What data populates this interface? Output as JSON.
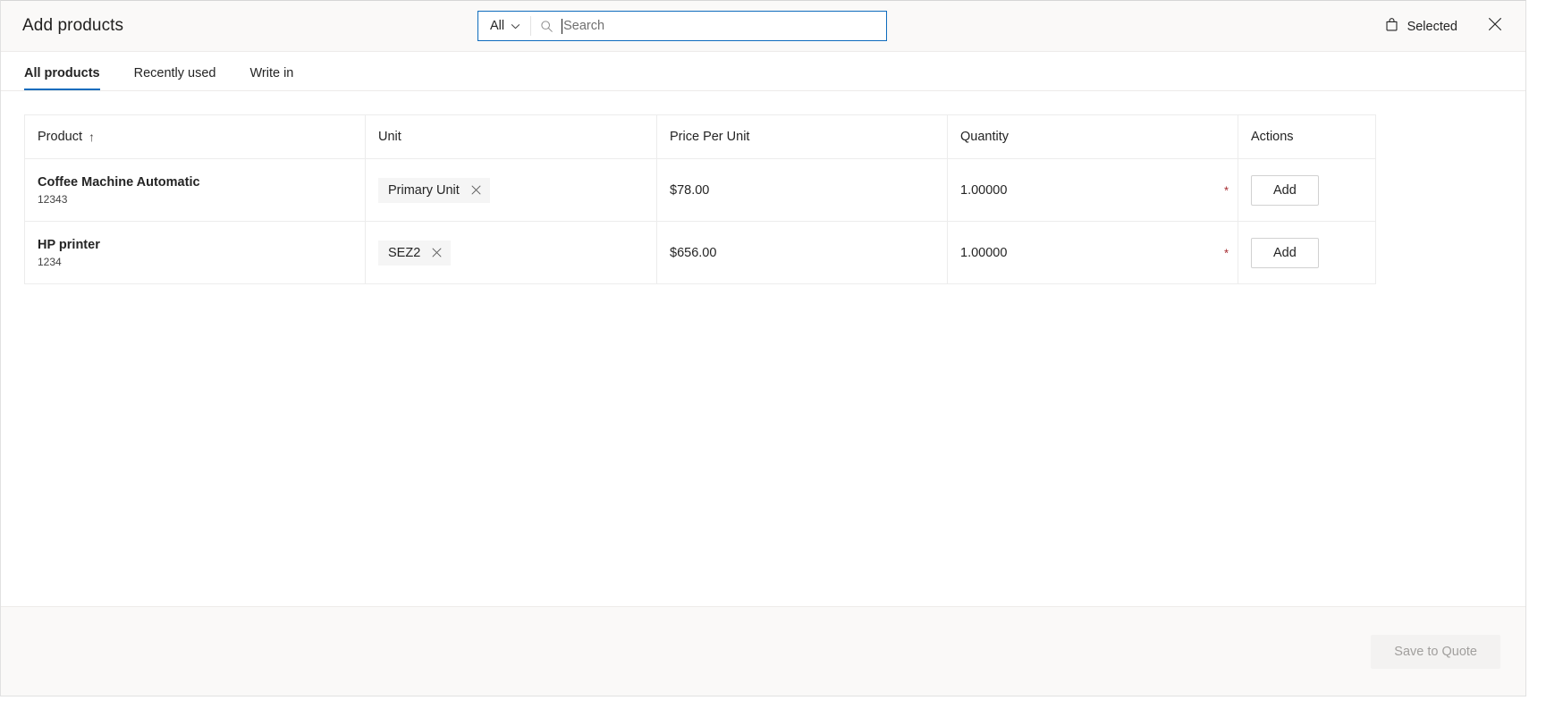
{
  "dialog": {
    "title": "Add products"
  },
  "search": {
    "scope_label": "All",
    "scope_icon": "chevron-down-icon",
    "icon": "search-icon",
    "placeholder": "Search",
    "value": ""
  },
  "header_actions": {
    "selected_label": "Selected",
    "selected_icon": "shopping-bag-icon",
    "close_icon": "close-icon"
  },
  "tabs": [
    {
      "label": "All products",
      "selected": true
    },
    {
      "label": "Recently used",
      "selected": false
    },
    {
      "label": "Write in",
      "selected": false
    }
  ],
  "table": {
    "columns": [
      {
        "label": "Product",
        "sort_indicator": "↑"
      },
      {
        "label": "Unit",
        "sort_indicator": ""
      },
      {
        "label": "Price Per Unit",
        "sort_indicator": ""
      },
      {
        "label": "Quantity",
        "sort_indicator": ""
      },
      {
        "label": "Actions",
        "sort_indicator": ""
      }
    ],
    "rows": [
      {
        "product_name": "Coffee Machine Automatic",
        "product_code": "12343",
        "unit": "Primary Unit",
        "unit_remove_icon": "close-icon",
        "price_per_unit": "$78.00",
        "quantity": "1.00000",
        "quantity_required_marker": "*",
        "action_label": "Add"
      },
      {
        "product_name": "HP printer",
        "product_code": "1234",
        "unit": "SEZ2",
        "unit_remove_icon": "close-icon",
        "price_per_unit": "$656.00",
        "quantity": "1.00000",
        "quantity_required_marker": "*",
        "action_label": "Add"
      }
    ]
  },
  "footer": {
    "save_label": "Save to Quote",
    "save_disabled": true
  },
  "colors": {
    "accent": "#0f6cbd",
    "header_bg": "#faf9f8",
    "border": "#ececec",
    "required": "#a4262c",
    "disabled_text": "#a19f9d"
  }
}
